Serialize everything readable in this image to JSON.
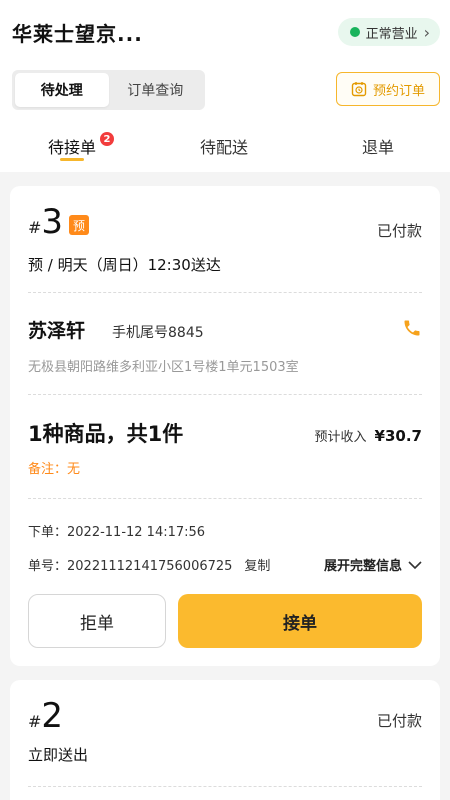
{
  "header": {
    "store_name": "华莱士望京...",
    "status_label": "正常营业",
    "status_chevron": "›",
    "status_color": "#19b35c"
  },
  "segment": {
    "tabs": [
      {
        "label": "待处理",
        "active": true
      },
      {
        "label": "订单查询",
        "active": false
      }
    ]
  },
  "reserve_button": {
    "label": "预约订单",
    "icon": "calendar-clock-icon"
  },
  "subtabs": [
    {
      "label": "待接单",
      "badge": "2",
      "active": true
    },
    {
      "label": "待配送",
      "active": false
    },
    {
      "label": "退单",
      "active": false
    }
  ],
  "orders": [
    {
      "hash": "#",
      "number": "3",
      "pre_tag": "预",
      "pay_status": "已付款",
      "delivery": "预 / 明天（周日）12:30送达",
      "customer_name": "苏泽轩",
      "phone_tail": "手机尾号8845",
      "address": "无极县朝阳路维多利亚小区1号楼1单元1503室",
      "goods_summary": "1种商品，共1件",
      "income_label": "预计收入",
      "income_amount": "¥30.7",
      "remark": "备注：无",
      "order_time": "下单：2022-11-12 14:17:56",
      "order_no": "单号：20221112141756006725",
      "copy_label": "复制",
      "expand_label": "展开完整信息",
      "reject_label": "拒单",
      "accept_label": "接单"
    },
    {
      "hash": "#",
      "number": "2",
      "pay_status": "已付款",
      "delivery": "立即送出"
    }
  ],
  "colors": {
    "accent": "#fbba2e",
    "accent_border": "#f6b62c",
    "orange": "#ff8a1a",
    "badge": "#f23c3c"
  }
}
